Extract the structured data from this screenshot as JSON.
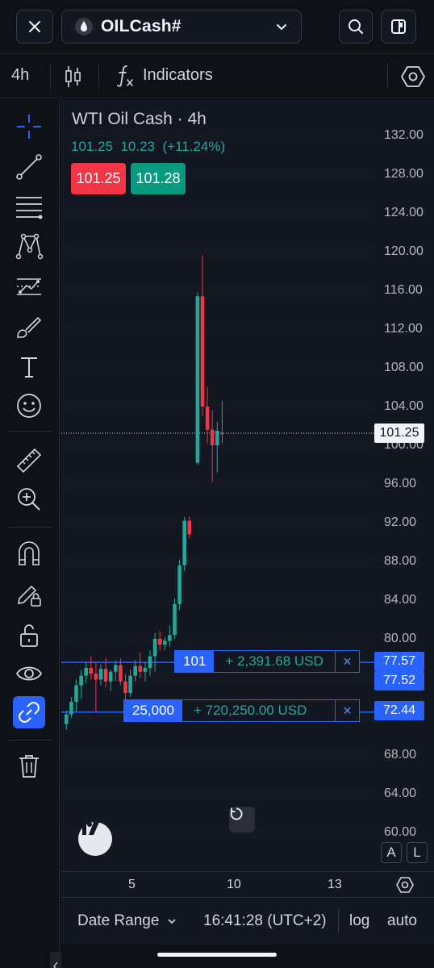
{
  "header": {
    "symbol": "OILCash#",
    "timeframe": "4h",
    "indicators_label": "Indicators"
  },
  "legend": {
    "title": "WTI Oil Cash · 4h",
    "last": "101.25",
    "change": "10.23",
    "change_pct": "(+11.24%)",
    "sell_price": "101.25",
    "buy_price": "101.28"
  },
  "colors": {
    "up": "#26a69a",
    "down": "#f23645",
    "accent": "#2962ff"
  },
  "price_axis": {
    "ticks": [
      "132.00",
      "128.00",
      "124.00",
      "120.00",
      "116.00",
      "112.00",
      "108.00",
      "104.00",
      "100.00",
      "96.00",
      "92.00",
      "88.00",
      "84.00",
      "80.00",
      "68.00",
      "64.00",
      "60.00"
    ],
    "current_price": "101.25",
    "order_price_1": "77.57",
    "order_price_2": "77.52",
    "order_price_3": "72.44"
  },
  "orders": [
    {
      "qty": "101",
      "pnl": "+ 2,391.68 USD",
      "close": "×"
    },
    {
      "qty": "25,000",
      "pnl": "+ 720,250.00 USD",
      "close": "×"
    }
  ],
  "time_axis": {
    "ticks": [
      "5",
      "10",
      "13"
    ]
  },
  "scale_buttons": {
    "a": "A",
    "l": "L"
  },
  "footer": {
    "date_range": "Date Range",
    "clock": "16:41:28 (UTC+2)",
    "log": "log",
    "auto": "auto"
  },
  "chart_data": {
    "type": "candlestick",
    "title": "WTI Oil Cash · 4h",
    "ylim": [
      60,
      132
    ],
    "candles": [
      {
        "o": 71.2,
        "h": 72.6,
        "l": 70.6,
        "c": 72.2
      },
      {
        "o": 72.2,
        "h": 74.0,
        "l": 71.8,
        "c": 73.5
      },
      {
        "o": 73.5,
        "h": 75.8,
        "l": 72.5,
        "c": 75.2
      },
      {
        "o": 75.2,
        "h": 76.8,
        "l": 73.8,
        "c": 76.2
      },
      {
        "o": 76.2,
        "h": 77.6,
        "l": 75.4,
        "c": 77.0
      },
      {
        "o": 77.0,
        "h": 78.2,
        "l": 75.8,
        "c": 76.4
      },
      {
        "o": 76.4,
        "h": 77.6,
        "l": 72.4,
        "c": 75.8
      },
      {
        "o": 75.8,
        "h": 77.4,
        "l": 75.2,
        "c": 76.9
      },
      {
        "o": 76.9,
        "h": 78.0,
        "l": 75.0,
        "c": 75.6
      },
      {
        "o": 75.6,
        "h": 76.8,
        "l": 74.6,
        "c": 76.6
      },
      {
        "o": 76.6,
        "h": 77.8,
        "l": 75.6,
        "c": 77.3
      },
      {
        "o": 77.3,
        "h": 78.0,
        "l": 75.2,
        "c": 75.6
      },
      {
        "o": 75.6,
        "h": 76.4,
        "l": 73.4,
        "c": 74.4
      },
      {
        "o": 74.4,
        "h": 76.8,
        "l": 74.0,
        "c": 76.2
      },
      {
        "o": 76.2,
        "h": 77.8,
        "l": 75.6,
        "c": 77.2
      },
      {
        "o": 77.2,
        "h": 78.6,
        "l": 76.0,
        "c": 76.6
      },
      {
        "o": 76.6,
        "h": 77.6,
        "l": 75.6,
        "c": 77.0
      },
      {
        "o": 77.0,
        "h": 78.8,
        "l": 76.2,
        "c": 78.2
      },
      {
        "o": 78.2,
        "h": 80.6,
        "l": 76.6,
        "c": 80.0
      },
      {
        "o": 80.0,
        "h": 80.8,
        "l": 78.8,
        "c": 79.4
      },
      {
        "o": 79.4,
        "h": 80.2,
        "l": 78.8,
        "c": 79.8
      },
      {
        "o": 79.8,
        "h": 81.4,
        "l": 79.2,
        "c": 80.4
      },
      {
        "o": 80.4,
        "h": 84.2,
        "l": 80.0,
        "c": 83.6
      },
      {
        "o": 83.6,
        "h": 88.2,
        "l": 83.0,
        "c": 87.6
      },
      {
        "o": 87.6,
        "h": 92.6,
        "l": 87.0,
        "c": 92.2
      },
      {
        "o": 92.2,
        "h": 92.6,
        "l": 90.4,
        "c": 90.8
      },
      {
        "o": 98.2,
        "h": 115.8,
        "l": 98.0,
        "c": 115.4
      },
      {
        "o": 115.4,
        "h": 119.6,
        "l": 103.0,
        "c": 104.0
      },
      {
        "o": 104.0,
        "h": 106.0,
        "l": 100.2,
        "c": 101.6
      },
      {
        "o": 101.6,
        "h": 103.6,
        "l": 96.2,
        "c": 100.0
      },
      {
        "o": 100.0,
        "h": 102.4,
        "l": 97.2,
        "c": 101.5
      },
      {
        "o": 101.2,
        "h": 104.6,
        "l": 100.2,
        "c": 101.25
      }
    ]
  }
}
